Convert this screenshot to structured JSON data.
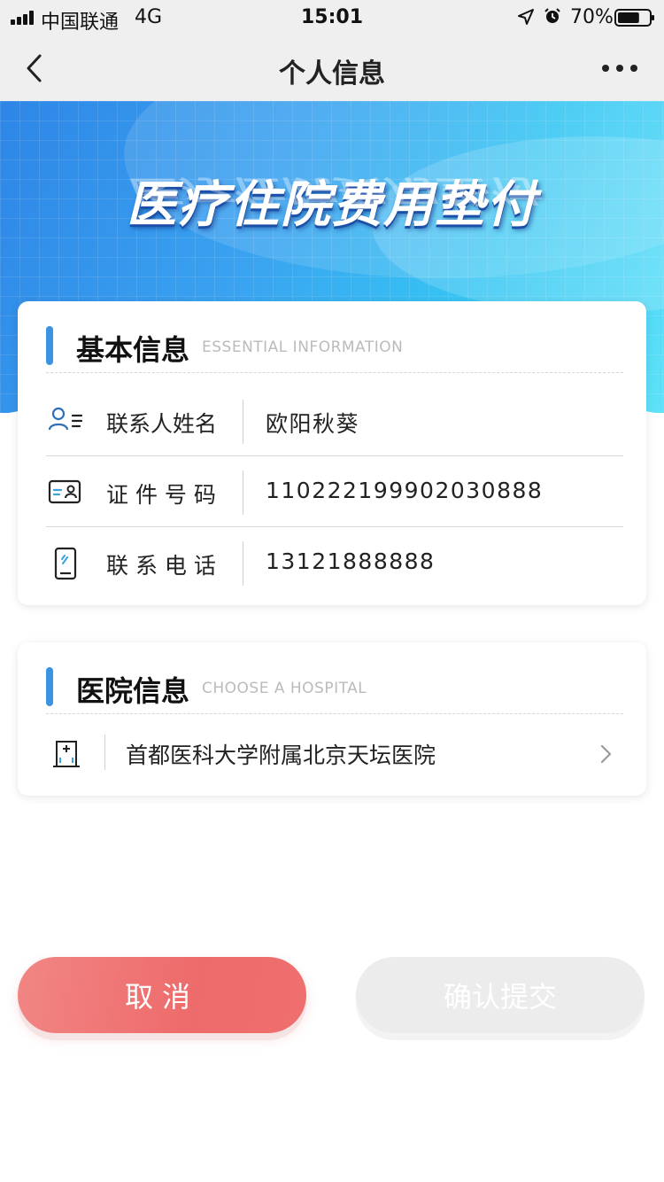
{
  "status_bar": {
    "carrier": "中国联通",
    "network": "4G",
    "time": "15:01",
    "battery": "70%",
    "battery_level": 0.7
  },
  "nav": {
    "title": "个人信息"
  },
  "banner": {
    "title": "医疗住院费用垫付"
  },
  "basic_info": {
    "title": "基本信息",
    "subtitle": "ESSENTIAL INFORMATION",
    "rows": [
      {
        "icon": "contact-person-icon",
        "label": "联系人姓名",
        "value": "欧阳秋葵"
      },
      {
        "icon": "id-card-icon",
        "label": "证 件 号 码",
        "value": "110222199902030888"
      },
      {
        "icon": "mobile-phone-icon",
        "label": "联 系 电 话",
        "value": "13121888888"
      }
    ]
  },
  "hospital_info": {
    "title": "医院信息",
    "subtitle": "CHOOSE A HOSPITAL",
    "hospital": "首都医科大学附属北京天坛医院"
  },
  "buttons": {
    "cancel": "取消",
    "confirm": "确认提交"
  },
  "colors": {
    "accent_blue": "#3b94e1",
    "cancel_red": "#ee6b6b",
    "confirm_disabled": "#ececec"
  }
}
